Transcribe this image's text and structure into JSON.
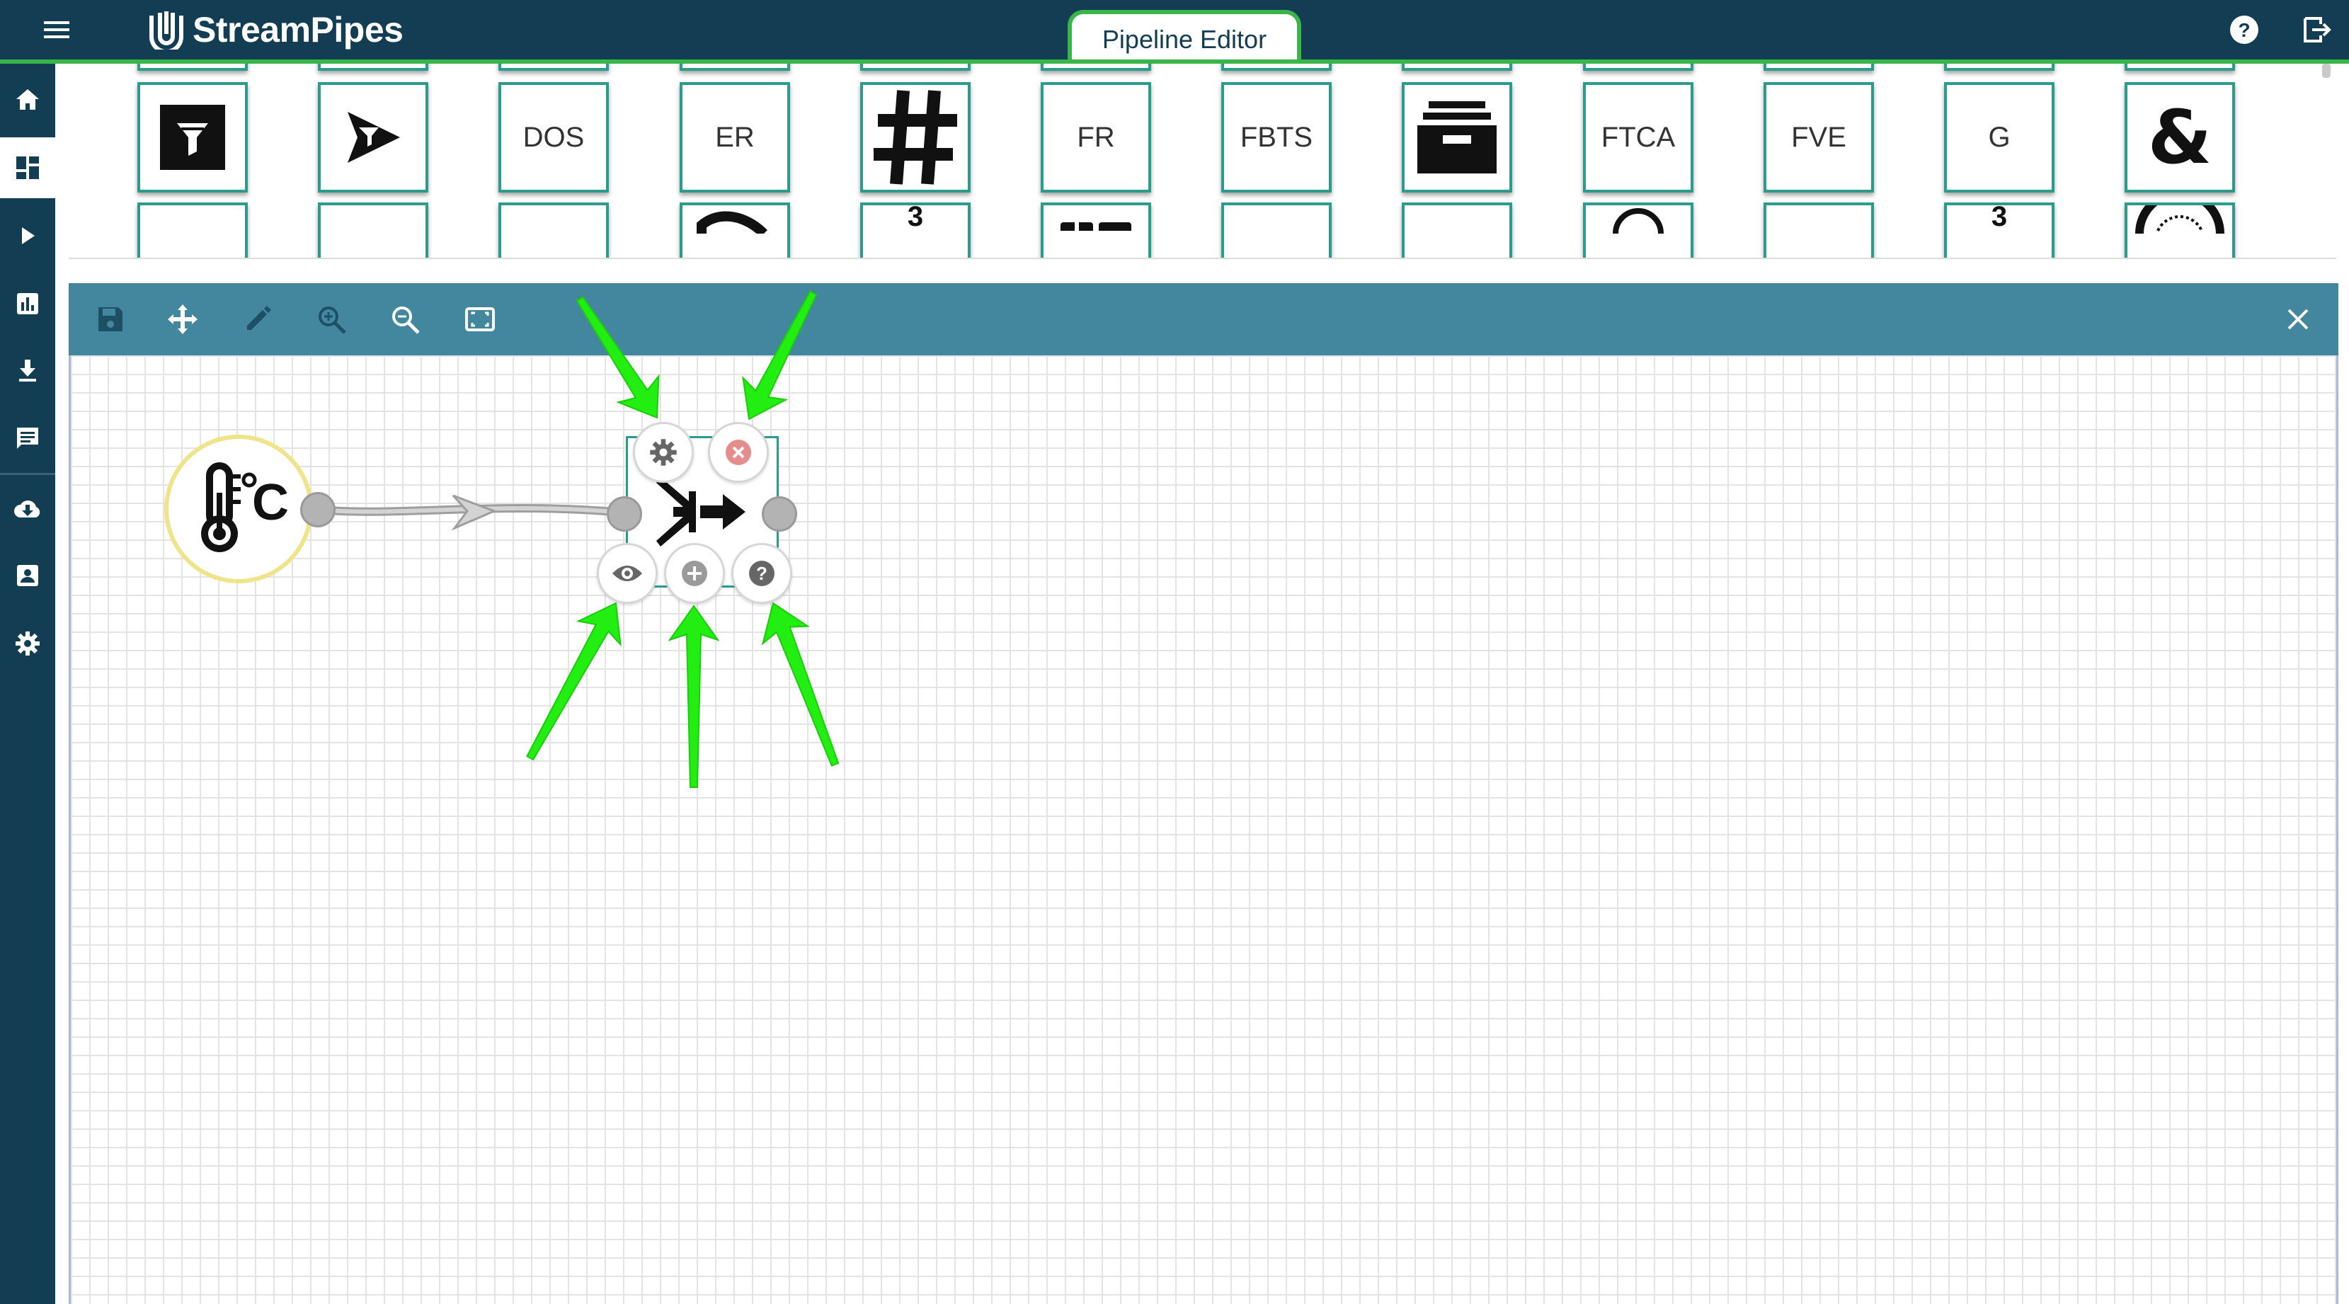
{
  "app": {
    "name": "StreamPipes"
  },
  "header": {
    "active_tab": "Pipeline Editor"
  },
  "palette": {
    "top_row": [
      {
        "label": "",
        "icon": "filter-funnel-icon"
      },
      {
        "label": "",
        "icon": "filter-arrow-icon"
      },
      {
        "label": "DOS",
        "icon": ""
      },
      {
        "label": "ER",
        "icon": ""
      },
      {
        "label": "",
        "icon": "hash-icon"
      },
      {
        "label": "FR",
        "icon": ""
      },
      {
        "label": "FBTS",
        "icon": ""
      },
      {
        "label": "",
        "icon": "archive-box-icon"
      },
      {
        "label": "FTCA",
        "icon": ""
      },
      {
        "label": "FVE",
        "icon": ""
      },
      {
        "label": "G",
        "icon": ""
      },
      {
        "label": "",
        "icon": "ampersand-icon"
      }
    ],
    "peek_row": [
      "",
      "",
      "",
      "",
      "3",
      "",
      "",
      "",
      "",
      "",
      "3",
      ""
    ]
  },
  "canvas": {
    "source_node": {
      "icon": "thermometer-celsius-icon",
      "unit": "°C"
    },
    "processor_node": {
      "icon": "merge-arrows-icon"
    },
    "context_menu": [
      "gear-icon",
      "delete-icon",
      "eye-icon",
      "add-icon",
      "help-icon"
    ]
  },
  "colors": {
    "header": "#123d53",
    "accent_green": "#39b54a",
    "toolbar": "#43879f",
    "card_border": "#2b9c8c",
    "source_border": "#efe48a",
    "annotation_arrow": "#22ee11"
  }
}
